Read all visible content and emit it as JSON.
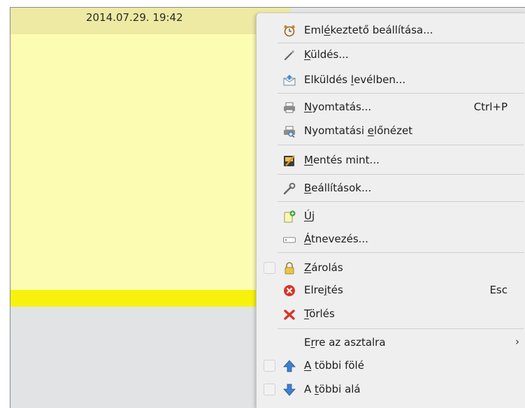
{
  "note": {
    "date": "2014.07.29. 19:42"
  },
  "menu": {
    "reminder": {
      "pre": "Eml",
      "ul": "é",
      "post": "keztető beállítása..."
    },
    "send": {
      "pre": "",
      "ul": "K",
      "post": "üldés..."
    },
    "send_mail": {
      "pre": "Elküldés ",
      "ul": "l",
      "post": "evélben..."
    },
    "print": {
      "pre": "",
      "ul": "N",
      "post": "yomtatás...",
      "shortcut": "Ctrl+P"
    },
    "print_preview": {
      "pre": "Nyomtatási ",
      "ul": "e",
      "post": "lőnézet"
    },
    "save_as": {
      "pre": "",
      "ul": "M",
      "post": "entés mint..."
    },
    "settings": {
      "pre": "",
      "ul": "B",
      "post": "eállítások..."
    },
    "new": {
      "pre": "",
      "ul": "Ú",
      "post": "j"
    },
    "rename": {
      "pre": "",
      "ul": "Á",
      "post": "tnevezés..."
    },
    "lock": {
      "pre": "",
      "ul": "Z",
      "post": "árolás"
    },
    "hide": {
      "pre": "Elre",
      "ul": "j",
      "post": "tés",
      "shortcut": "Esc"
    },
    "delete": {
      "pre": "",
      "ul": "T",
      "post": "örlés"
    },
    "to_desktop": {
      "pre": "E",
      "ul": "r",
      "post": "re az asztalra",
      "arrow": "›"
    },
    "above": {
      "pre": "",
      "ul": "A",
      "post": " többi fölé"
    },
    "below": {
      "pre": "A ",
      "ul": "t",
      "post": "öbbi alá"
    }
  },
  "colors": {
    "note_header": "#eeeaa3",
    "note_body": "#fdfcb3",
    "note_bottom": "#f7f20b",
    "menu_bg": "#efefef"
  }
}
